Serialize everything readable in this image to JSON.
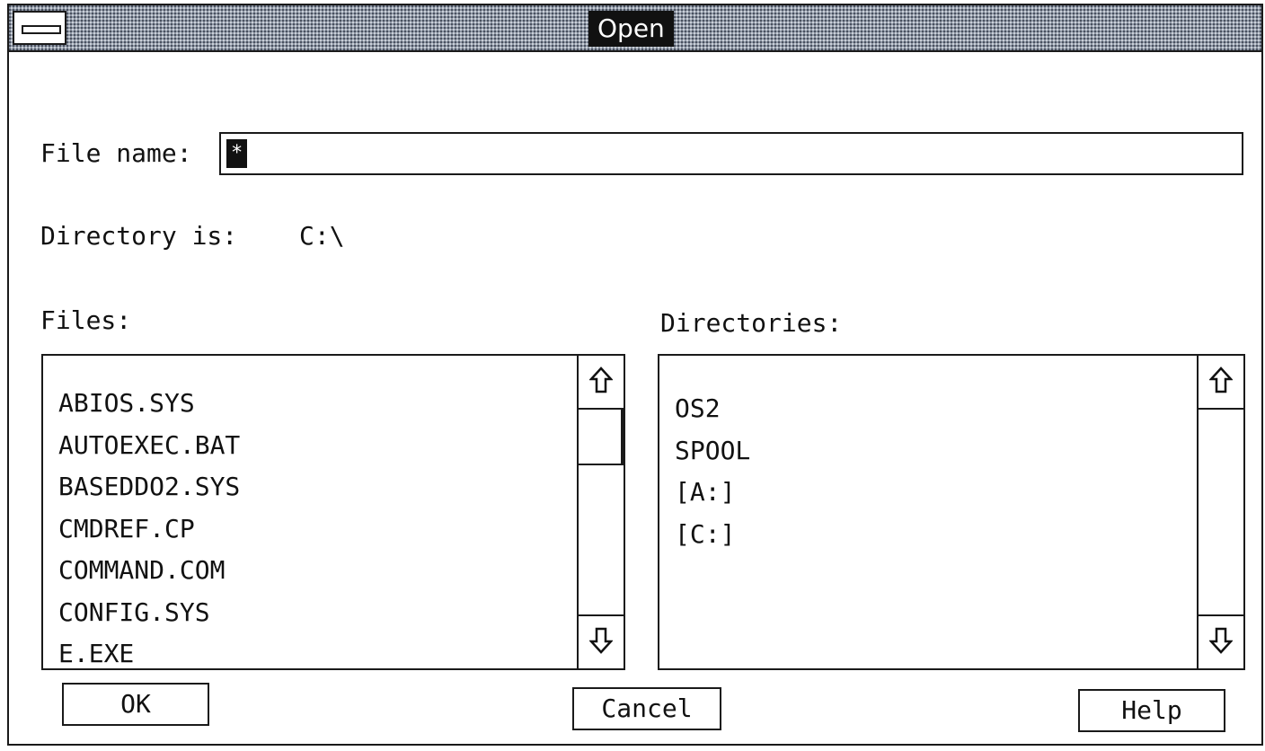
{
  "dialog": {
    "title": "Open",
    "file_name_label": "File name:",
    "file_name_value": "*",
    "directory_label": "Directory is:",
    "directory_value": "C:\\",
    "files_label": "Files:",
    "directories_label": "Directories:",
    "files": [
      "ABIOS.SYS",
      "AUTOEXEC.BAT",
      "BASEDDO2.SYS",
      "CMDREF.CP",
      "COMMAND.COM",
      "CONFIG.SYS",
      "E.EXE"
    ],
    "directories": [
      "OS2",
      "SPOOL",
      "[A:]",
      "[C:]"
    ],
    "buttons": {
      "ok": "OK",
      "cancel": "Cancel",
      "help": "Help"
    }
  },
  "icons": {
    "system_menu": "system-menu-icon",
    "scroll_up": "arrow-up-icon",
    "scroll_down": "arrow-down-icon"
  }
}
